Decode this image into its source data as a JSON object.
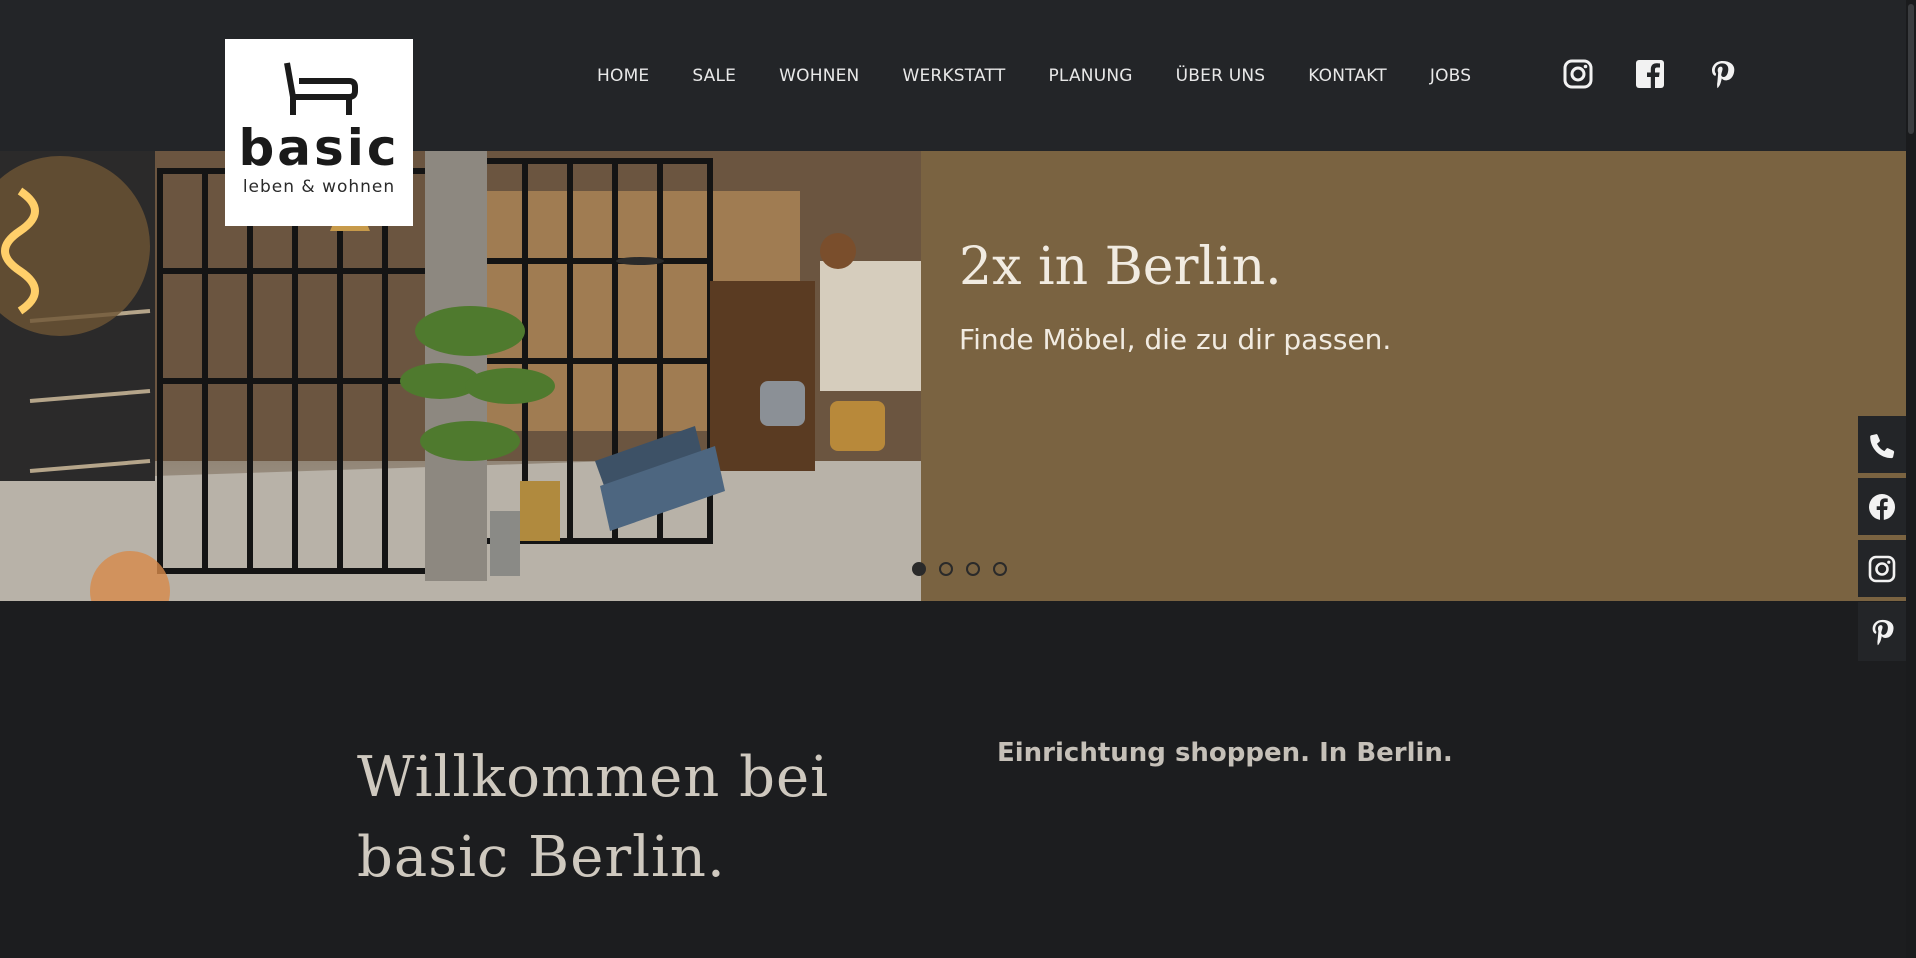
{
  "logo": {
    "word": "basic",
    "sub": "leben & wohnen"
  },
  "nav": {
    "items": [
      "HOME",
      "SALE",
      "WOHNEN",
      "WERKSTATT",
      "PLANUNG",
      "ÜBER UNS",
      "KONTAKT",
      "JOBS"
    ],
    "social": [
      "instagram-icon",
      "facebook-icon",
      "pinterest-icon"
    ]
  },
  "hero": {
    "title": "2x in Berlin.",
    "subtitle": "Finde Möbel, die zu dir passen.",
    "slides": 4,
    "active_slide": 1,
    "panel_color": "#7a6341"
  },
  "sidebar": {
    "icons": [
      "phone-icon",
      "facebook-icon",
      "instagram-icon",
      "pinterest-icon"
    ]
  },
  "welcome": {
    "title_line1": "Willkommen bei",
    "title_line2": "basic Berlin.",
    "right_heading": "Einrichtung shoppen. In Berlin."
  },
  "colors": {
    "header_bg": "#232528",
    "body_bg": "#1c1d1f",
    "accent": "#7a6341"
  }
}
